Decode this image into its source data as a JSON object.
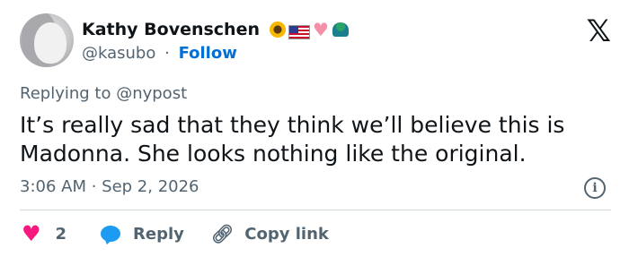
{
  "author": {
    "name": "Kathy Bovenschen",
    "handle": "@kasubo",
    "separator": "·",
    "follow_label": "Follow",
    "emoji_icons": [
      "sunflower-icon",
      "us-flag-icon",
      "pink-heart-icon",
      "peacock-icon"
    ]
  },
  "brand": {
    "logo_text": "𝕏"
  },
  "tweet": {
    "replying_to": "Replying to @nypost",
    "text": "It’s really sad that they think we’ll believe this is Madonna. She looks nothing like the original.",
    "timestamp": "3:06 AM · Sep 2, 2026"
  },
  "actions": {
    "like_count": "2",
    "reply_label": "Reply",
    "copy_link_label": "Copy link"
  },
  "colors": {
    "follow": "#006fd6",
    "like": "#f91880",
    "reply": "#1d9bf0",
    "muted": "#536471"
  }
}
